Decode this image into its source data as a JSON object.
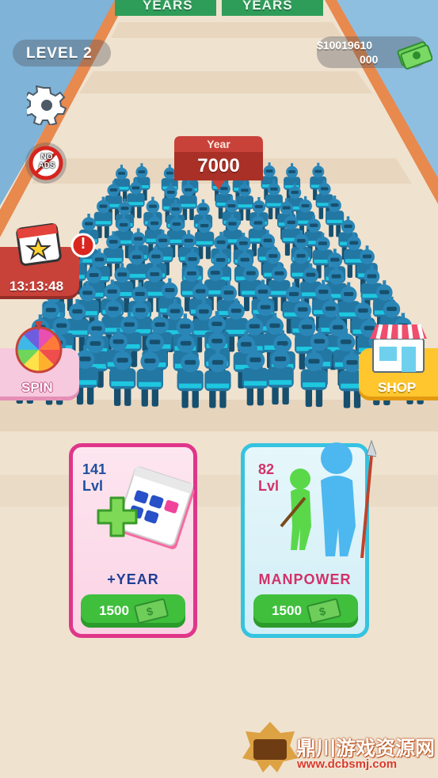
{
  "top_banner": {
    "left_label": "YEARS",
    "right_label": "YEARS"
  },
  "hud": {
    "level_label": "LEVEL 2",
    "money_line1": "$10019610",
    "money_line2": "000"
  },
  "buttons": {
    "no_ads": "NO ADS",
    "timer": "13:13:48",
    "spin_label": "SPIN",
    "shop_label": "SHOP",
    "alert_mark": "!"
  },
  "year_badge": {
    "label": "Year",
    "value": "7000"
  },
  "cards": {
    "year": {
      "level_num": "141",
      "level_word": "Lvl",
      "title": "+YEAR",
      "price": "1500"
    },
    "manpower": {
      "level_num": "82",
      "level_word": "Lvl",
      "title": "MANPOWER",
      "price": "1500"
    }
  },
  "watermark": {
    "title": "鼎川游戏资源网",
    "url": "www.dcbsmj.com"
  },
  "colors": {
    "track": "#efe4d3",
    "robot": "#1f6f99",
    "year_card_border": "#e0368a",
    "manpower_card_border": "#35c3e0",
    "green_button": "#3fbf3c",
    "badge_red": "#c8423a"
  },
  "icons": [
    "gear-icon",
    "no-ads-icon",
    "calendar-star-icon",
    "alert-icon",
    "spin-wheel-icon",
    "shop-icon",
    "cash-icon",
    "calendar-plus-icon",
    "soldier-icon"
  ]
}
